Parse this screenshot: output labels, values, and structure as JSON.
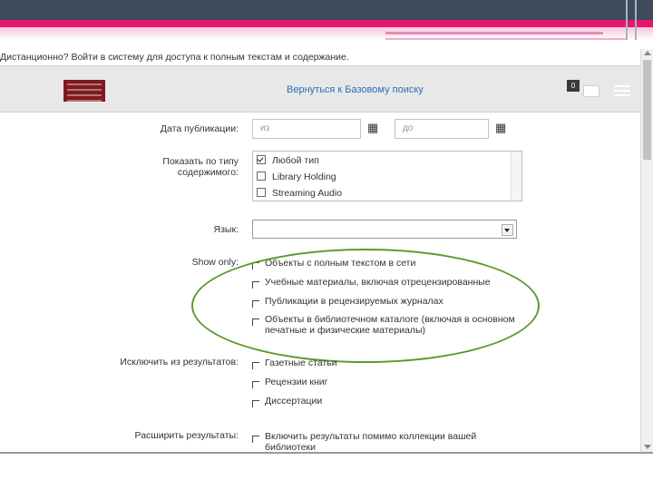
{
  "banner_text": "Дистанционно? Войти в систему для доступа к полным текстам и содержание.",
  "header": {
    "back_link": "Вернуться к Базовому поиску",
    "badge_count": "0"
  },
  "form": {
    "pub_date_label": "Дата публикации:",
    "from_placeholder": "из",
    "to_placeholder": "до",
    "content_type_label_1": "Показать по типу",
    "content_type_label_2": "содержимого:",
    "content_types": [
      "Любой тип",
      "Library Holding",
      "Streaming Audio"
    ],
    "language_label": "Язык:",
    "show_only_label": "Show only:",
    "show_only_options": [
      "Объекты с полным текстом в сети",
      "Учебные материалы, включая отрецензированные",
      "Публикации в рецензируемых журналах",
      "Объекты в библиотечном каталоге (включая в основном",
      "печатные и физические материалы)"
    ],
    "exclude_label": "Исключить из результатов:",
    "exclude_options": [
      "Газетные статьи",
      "Рецензии книг",
      "Диссертации"
    ],
    "expand_label": "Расширить результаты:",
    "expand_option_1": "Включить результаты помимо коллекции вашей",
    "expand_option_2": "библиотеки"
  },
  "colors": {
    "top_bar": "#3d4b5b",
    "accent_pink": "#e5176e",
    "link_blue": "#2a6fb5",
    "highlight_green": "#5c9a2c",
    "logo_red": "#7e1a22"
  }
}
